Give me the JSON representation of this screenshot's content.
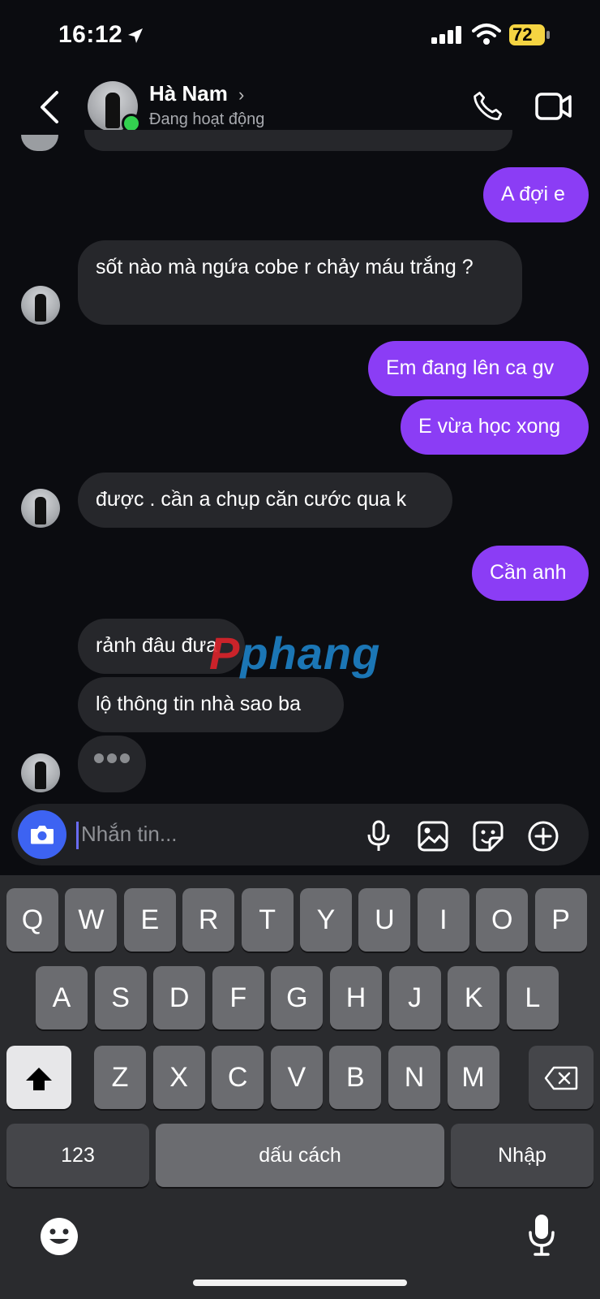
{
  "status_bar": {
    "time": "16:12",
    "battery": "72"
  },
  "header": {
    "contact_name": "Hà Nam",
    "chevron": "›",
    "presence": "Đang hoạt động"
  },
  "messages": [
    {
      "direction": "outgoing",
      "text": "A đợi e"
    },
    {
      "direction": "incoming",
      "text": "sốt nào mà ngứa cobe r chảy máu trắng ?"
    },
    {
      "direction": "outgoing",
      "text": "Em đang lên ca gv"
    },
    {
      "direction": "outgoing",
      "text": "E vừa học xong"
    },
    {
      "direction": "incoming",
      "text": "được . cần a chụp căn cước qua k"
    },
    {
      "direction": "outgoing",
      "text": "Cần anh"
    },
    {
      "direction": "incoming",
      "text": "rảnh đâu đưa"
    },
    {
      "direction": "incoming",
      "text": "lộ thông tin nhà sao ba"
    }
  ],
  "watermark": {
    "part1": "P",
    "part2": "phang"
  },
  "composer": {
    "placeholder": "Nhắn tin...",
    "icons": [
      "camera-icon",
      "microphone-icon",
      "gallery-icon",
      "sticker-icon",
      "plus-icon"
    ]
  },
  "keyboard": {
    "row1": [
      "Q",
      "W",
      "E",
      "R",
      "T",
      "Y",
      "U",
      "I",
      "O",
      "P"
    ],
    "row2": [
      "A",
      "S",
      "D",
      "F",
      "G",
      "H",
      "J",
      "K",
      "L"
    ],
    "row3": [
      "Z",
      "X",
      "C",
      "V",
      "B",
      "N",
      "M"
    ],
    "numbers": "123",
    "space": "dấu cách",
    "return": "Nhập"
  },
  "colors": {
    "outgoing_bubble": "#8b3df5",
    "incoming_bubble": "#26272b",
    "online": "#33d14f",
    "camera_button": "#3d63f2"
  }
}
